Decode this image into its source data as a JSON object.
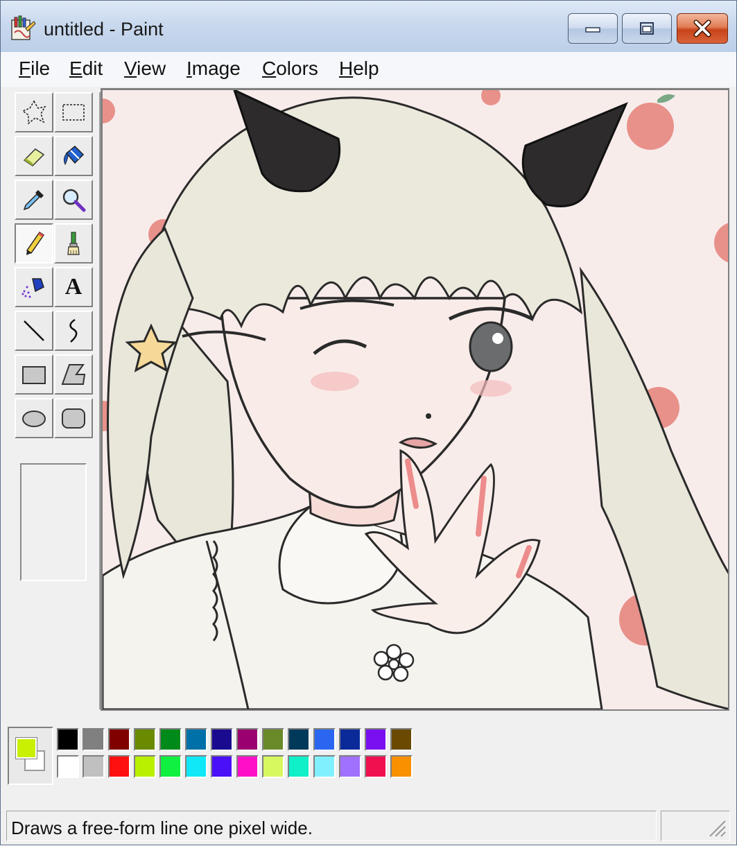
{
  "window": {
    "title": "untitled - Paint",
    "icon": "paint-app-icon"
  },
  "menu": [
    {
      "accel": "F",
      "rest": "ile"
    },
    {
      "accel": "E",
      "rest": "dit"
    },
    {
      "accel": "V",
      "rest": "iew"
    },
    {
      "accel": "I",
      "rest": "mage"
    },
    {
      "accel": "C",
      "rest": "olors"
    },
    {
      "accel": "H",
      "rest": "elp"
    }
  ],
  "tools": [
    {
      "name": "free-form-select-icon",
      "selected": false
    },
    {
      "name": "rectangle-select-icon",
      "selected": false
    },
    {
      "name": "eraser-icon",
      "selected": false
    },
    {
      "name": "fill-bucket-icon",
      "selected": false
    },
    {
      "name": "color-picker-icon",
      "selected": false
    },
    {
      "name": "magnifier-icon",
      "selected": false
    },
    {
      "name": "pencil-icon",
      "selected": true
    },
    {
      "name": "brush-icon",
      "selected": false
    },
    {
      "name": "airbrush-icon",
      "selected": false
    },
    {
      "name": "text-tool-icon",
      "glyph": "A",
      "selected": false
    },
    {
      "name": "line-icon",
      "selected": false
    },
    {
      "name": "curve-icon",
      "selected": false
    },
    {
      "name": "rectangle-icon",
      "selected": false
    },
    {
      "name": "polygon-icon",
      "selected": false
    },
    {
      "name": "ellipse-icon",
      "selected": false
    },
    {
      "name": "rounded-rectangle-icon",
      "selected": false
    }
  ],
  "colors": {
    "foreground": "#c8f000",
    "background": "#ffffff",
    "palette_top": [
      "#000000",
      "#808080",
      "#800000",
      "#6a8a00",
      "#008a1a",
      "#0070a8",
      "#1a0a90",
      "#9a0070",
      "#6a8a2a",
      "#003a5a",
      "#2a66f0",
      "#0a2a9a",
      "#7a10f0",
      "#6a4a00"
    ],
    "palette_bottom": [
      "#ffffff",
      "#c0c0c0",
      "#ff1010",
      "#b8f000",
      "#10f040",
      "#10e8f8",
      "#4a10f8",
      "#ff10c8",
      "#d8f860",
      "#10f0c8",
      "#80f0ff",
      "#a070ff",
      "#f01050",
      "#f89000"
    ]
  },
  "status": {
    "text": "Draws a free-form line one pixel wide."
  }
}
